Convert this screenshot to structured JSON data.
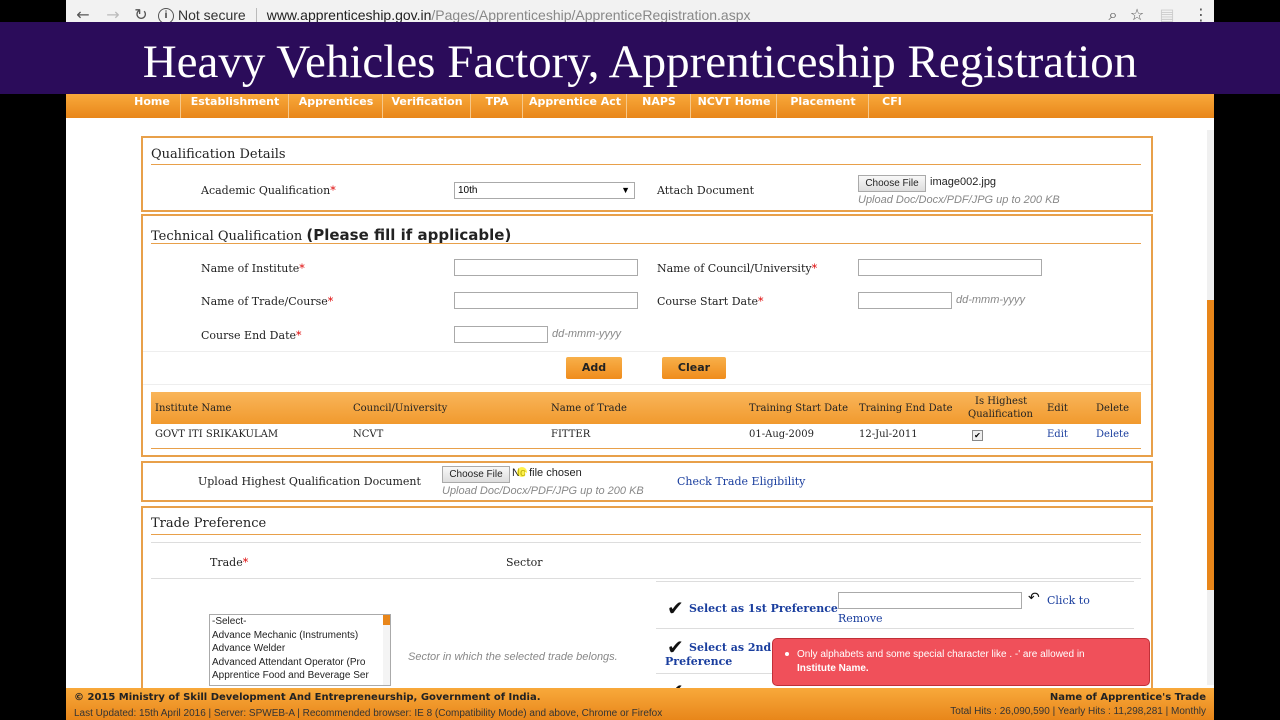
{
  "browser": {
    "security_label": "Not secure",
    "url_host": "www.apprenticeship.gov.in",
    "url_path": "/Pages/Apprenticeship/ApprenticeRegistration.aspx"
  },
  "banner": {
    "title": "Heavy Vehicles Factory, Apprenticeship Registration"
  },
  "nav": {
    "items": [
      "Home",
      "Establishment",
      "Apprentices",
      "Verification",
      "TPA",
      "Apprentice Act",
      "NAPS",
      "NCVT Home",
      "Placement",
      "CFI"
    ]
  },
  "qualification": {
    "title": "Qualification Details",
    "academic_label": "Academic Qualification",
    "required_mark": "*",
    "academic_value": "10th",
    "attach_label": "Attach Document",
    "choose_file": "Choose File",
    "file_name": "image002.jpg",
    "upload_hint": "Upload Doc/Docx/PDF/JPG up to 200 KB"
  },
  "technical": {
    "title": "Technical Qualification",
    "title_note": "(Please fill if applicable)",
    "institute_label": "Name of Institute",
    "council_label": "Name of Council/University",
    "trade_label": "Name of Trade/Course",
    "start_label": "Course Start Date",
    "end_label": "Course End Date",
    "date_hint": "dd-mmm-yyyy",
    "add_button": "Add",
    "clear_button": "Clear",
    "table": {
      "headers": [
        "Institute Name",
        "Council/University",
        "Name of Trade",
        "Training Start Date",
        "Training End Date",
        "Is Highest",
        "Qualification",
        "Edit",
        "Delete"
      ],
      "rows": [
        {
          "institute": "GOVT ITI SRIKAKULAM",
          "council": "NCVT",
          "trade": "FITTER",
          "start": "01-Aug-2009",
          "end": "12-Jul-2011",
          "highest": "✔",
          "edit": "Edit",
          "delete": "Delete"
        }
      ]
    }
  },
  "upload_highest": {
    "label": "Upload Highest Qualification Document",
    "choose_file": "Choose File",
    "no_file": "No file chosen",
    "hint": "Upload Doc/Docx/PDF/JPG up to 200 KB",
    "check_link": "Check Trade Eligibility"
  },
  "trade_preference": {
    "title": "Trade Preference",
    "trade_header": "Trade",
    "sector_header": "Sector",
    "trade_options": [
      "-Select-",
      "Advance Mechanic (Instruments)",
      "Advance Welder",
      "Advanced Attendant Operator (Pro",
      "Apprentice Food and Beverage Ser"
    ],
    "sector_hint": "Sector in which the selected trade belongs.",
    "pref1_label": "Select as 1st Preference",
    "pref2_label_a": "Select as 2nd",
    "pref2_label_b": "Preference",
    "click_to": "Click to",
    "remove": "Remove"
  },
  "tooltip": {
    "line1": "Only alphabets and some special character like . -' are allowed in",
    "line2": "Institute Name."
  },
  "footer": {
    "copyright": "© 2015 Ministry of Skill Development And Entrepreneurship, Government of India.",
    "right_label": "Name of Apprentice's Trade",
    "last_updated": "Last Updated: 15th April 2016 | Server: SPWEB-A | Recommended browser: IE 8 (Compatibility Mode) and above, Chrome or Firefox",
    "hits": "Total Hits : 26,090,590 | Yearly Hits : 11,298,281 | Monthly"
  }
}
